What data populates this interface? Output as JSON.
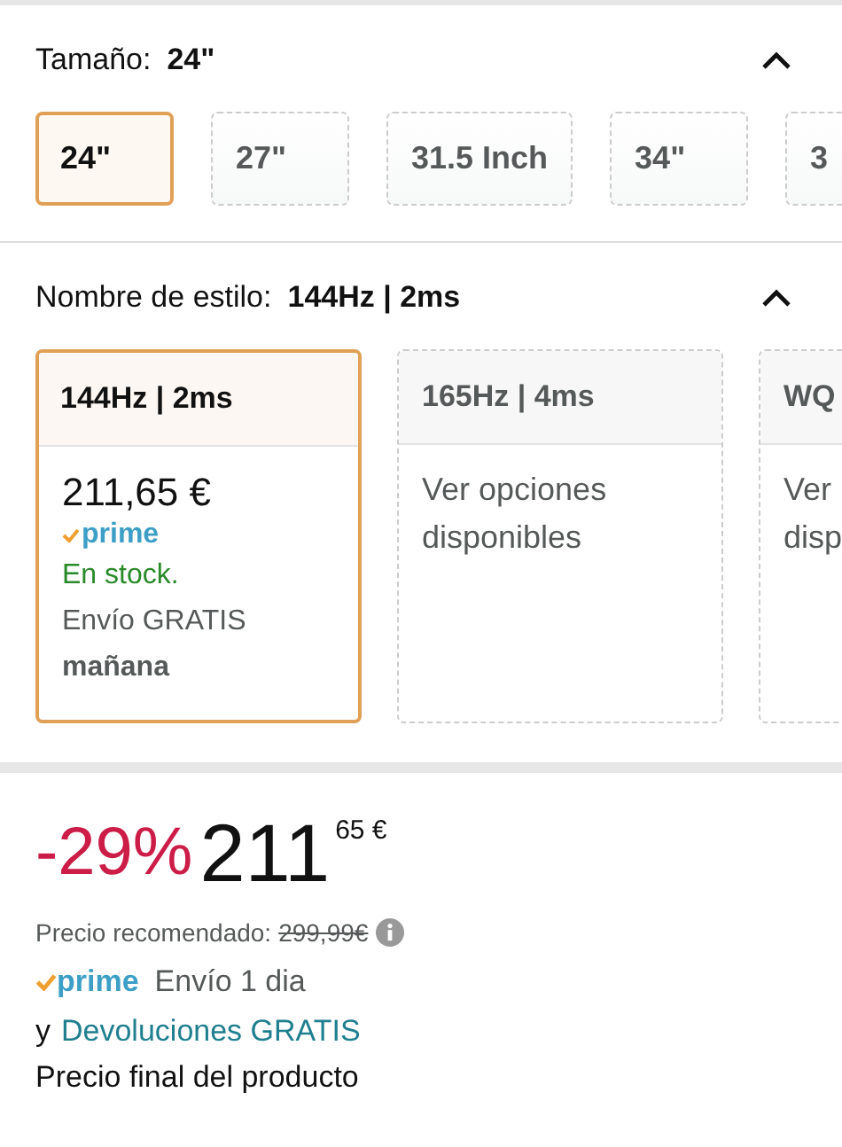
{
  "size_section": {
    "label": "Tamaño:",
    "value": "24\"",
    "expanded": true,
    "options": [
      {
        "label": "24\"",
        "selected": true
      },
      {
        "label": "27\"",
        "selected": false
      },
      {
        "label": "31.5 Inch",
        "selected": false
      },
      {
        "label": "34\"",
        "selected": false
      },
      {
        "label": "3",
        "selected": false
      }
    ]
  },
  "style_section": {
    "label": "Nombre de estilo:",
    "value": "144Hz | 2ms",
    "expanded": true,
    "options": [
      {
        "kind": "offer",
        "title": "144Hz | 2ms",
        "selected": true,
        "price": "211,65 €",
        "badge": "prime",
        "stock": "En stock.",
        "shipping": "Envío GRATIS",
        "delivery": "mañana"
      },
      {
        "kind": "options",
        "title": "165Hz | 4ms",
        "selected": false,
        "lines": [
          "Ver opciones",
          "disponibles"
        ]
      },
      {
        "kind": "options",
        "title": "WQ",
        "selected": false,
        "lines": [
          "Ver",
          "disp"
        ]
      }
    ]
  },
  "price_block": {
    "discount": "-29%",
    "whole": "211",
    "fraction": "65 €",
    "list_label": "Precio recomendado:",
    "list_price": "299,99€",
    "badge": "prime",
    "delivery": "Envío 1 dia",
    "returns_prefix": "y",
    "returns_link": "Devoluciones GRATIS",
    "note": "Precio final del producto"
  }
}
